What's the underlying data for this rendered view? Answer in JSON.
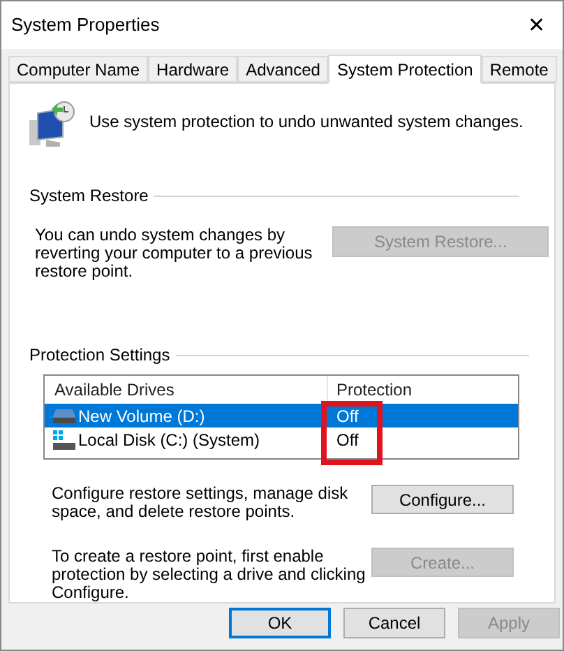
{
  "window": {
    "title": "System Properties",
    "close": "✕"
  },
  "tabs": [
    {
      "label": "Computer Name",
      "selected": false
    },
    {
      "label": "Hardware",
      "selected": false
    },
    {
      "label": "Advanced",
      "selected": false
    },
    {
      "label": "System Protection",
      "selected": true
    },
    {
      "label": "Remote",
      "selected": false
    }
  ],
  "intro": "Use system protection to undo unwanted system changes.",
  "system_restore": {
    "heading": "System Restore",
    "text": "You can undo system changes by reverting your computer to a previous restore point.",
    "button": {
      "label": "System Restore...",
      "disabled": true
    }
  },
  "protection_settings": {
    "heading": "Protection Settings",
    "columns": [
      "Available Drives",
      "Protection"
    ],
    "protection_highlighted": true,
    "drives": [
      {
        "name": "New Volume (D:)",
        "protection": "Off",
        "kind": "data",
        "selected": true
      },
      {
        "name": "Local Disk (C:) (System)",
        "protection": "Off",
        "kind": "system",
        "selected": false
      }
    ],
    "configure": {
      "text": "Configure restore settings, manage disk space, and delete restore points.",
      "button": {
        "label": "Configure...",
        "disabled": false
      }
    },
    "create": {
      "text": "To create a restore point, first enable protection by selecting a drive and clicking Configure.",
      "button": {
        "label": "Create...",
        "disabled": true
      }
    }
  },
  "buttons": [
    {
      "label": "OK",
      "default": true,
      "disabled": false
    },
    {
      "label": "Cancel",
      "default": false,
      "disabled": false
    },
    {
      "label": "Apply",
      "default": false,
      "disabled": true
    }
  ]
}
